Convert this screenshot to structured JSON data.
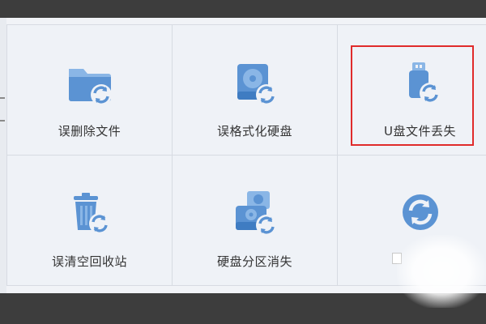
{
  "grid": {
    "items": [
      {
        "label": "误删除文件"
      },
      {
        "label": "误格式化硬盘"
      },
      {
        "label": "U盘文件丢失"
      },
      {
        "label": "误清空回收站"
      },
      {
        "label": "硬盘分区消失"
      },
      {
        "label": ""
      }
    ]
  },
  "highlight": {
    "color": "#e02b2b"
  },
  "colors": {
    "icon_blue": "#5b93d3",
    "icon_light": "#8ab6e6",
    "label_text": "#333333",
    "panel_bg": "#f1f3f7",
    "outer_bg": "#3d3d3d"
  }
}
